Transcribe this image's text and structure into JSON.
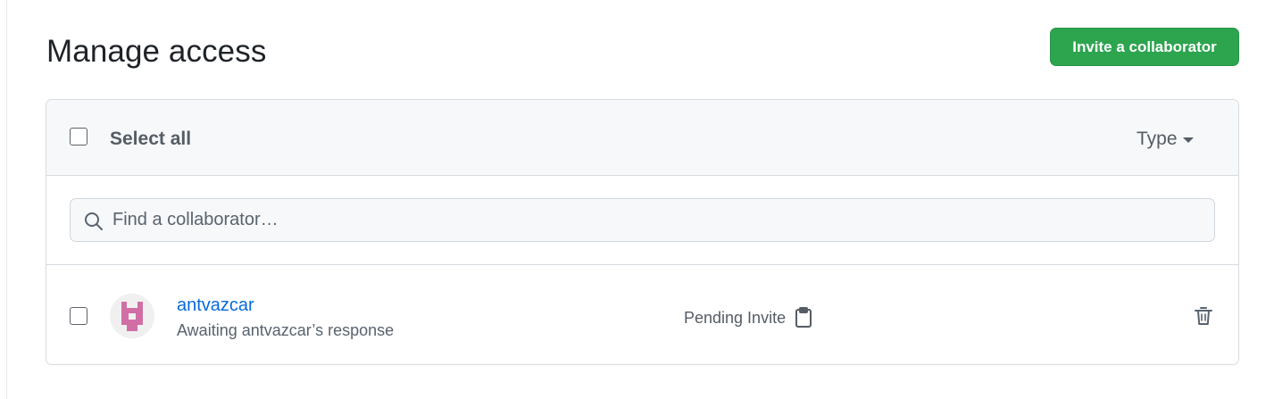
{
  "page": {
    "title": "Manage access"
  },
  "actions": {
    "invite_label": "Invite a collaborator"
  },
  "list_header": {
    "select_all_label": "Select all",
    "type_filter_label": "Type"
  },
  "search": {
    "placeholder": "Find a collaborator…",
    "value": ""
  },
  "collaborators": [
    {
      "username": "antvazcar",
      "status_text": "Awaiting antvazcar’s response",
      "role_label": "Pending Invite"
    }
  ],
  "colors": {
    "accent_green": "#2da44e",
    "link_blue": "#0969da",
    "avatar_pink": "#d16ea6"
  },
  "icons": {
    "search": "search-icon",
    "clipboard": "clipboard-icon",
    "trash": "trash-icon",
    "caret": "caret-down-icon"
  }
}
